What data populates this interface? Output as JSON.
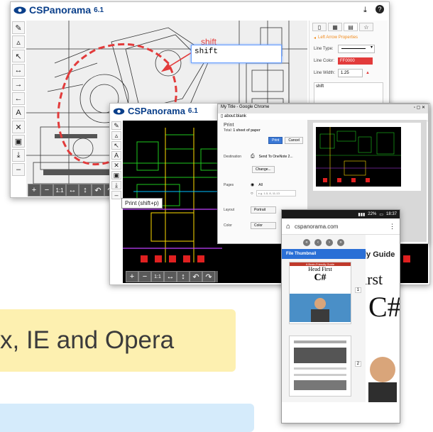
{
  "win1": {
    "logo_text": "CSPanorama",
    "version": "6.1",
    "callout_label": "shift",
    "textbox_value": "shift",
    "panel": {
      "title": "Left Arrow Properties",
      "line_type_label": "Line Type:",
      "line_color_label": "Line Color:",
      "line_color_value": "FF0000",
      "line_width_label": "Line Width:",
      "line_width_value": "1.25",
      "text_value": "shift"
    },
    "zoom_label": "1:1"
  },
  "win2": {
    "logo_text": "CSPanorama",
    "version": "6.1",
    "tooltip": "Print (shift+p)",
    "zoom_label": "1:1"
  },
  "print_dialog": {
    "tab_title": "My Title - Google Chrome",
    "url": "about:blank",
    "title": "Print",
    "total_prefix": "Total: ",
    "total_value": "1 sheet of paper",
    "print_button": "Print",
    "cancel_button": "Cancel",
    "destination_label": "Destination",
    "destination_value": "Send To OneNote 2...",
    "change_button": "Change...",
    "pages_label": "Pages",
    "pages_all": "All",
    "pages_range_placeholder": "e.g. 1-5, 8, 11-13",
    "layout_label": "Layout",
    "layout_value": "Portrait",
    "color_label": "Color",
    "color_value": "Color"
  },
  "phone": {
    "status_battery": "22%",
    "status_time": "18:37",
    "url": "cspanorama.com",
    "panel_title": "File Thumbnail",
    "page1_number": "1",
    "page2_number": "2",
    "book_brand": "A Brain-Friendly Guide",
    "book_title": "Head First",
    "book_subtitle": "C#",
    "bg_guide": "ly Guide",
    "bg_first": "irst"
  },
  "banners": {
    "yellow_text": "x, IE and Opera"
  },
  "colors": {
    "brand": "#0a3f8a",
    "accent_orange": "#f08a1c",
    "red": "#e23b3b",
    "chrome_blue": "#3a78d6",
    "yellow_banner": "#fdf0b0",
    "blue_banner": "#d5ebfb"
  }
}
